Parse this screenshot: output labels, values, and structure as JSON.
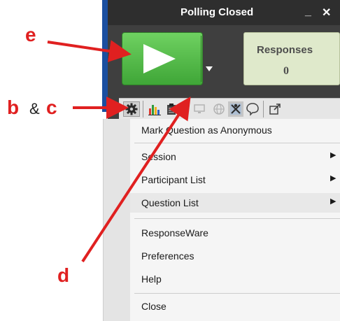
{
  "window": {
    "title": "Polling Closed",
    "minimize_glyph": "_",
    "close_glyph": "✕"
  },
  "start_button": {
    "icon": "play-icon",
    "dropdown_icon": "chevron-down-icon"
  },
  "responses": {
    "label": "Responses",
    "count": "0"
  },
  "toolbar": {
    "tools": [
      "gear-icon",
      "bar-chart-icon",
      "clipboard-icon",
      "monitor-icon",
      "globe-icon",
      "grid-icon",
      "speech-bubble-icon",
      "external-link-icon"
    ]
  },
  "menu": {
    "items": [
      {
        "label": "Mark Question as Anonymous",
        "submenu": false
      },
      {
        "label": "Session",
        "submenu": true
      },
      {
        "label": "Participant List",
        "submenu": true
      },
      {
        "label": "Question List",
        "submenu": true,
        "highlighted": true
      },
      {
        "label": "ResponseWare",
        "submenu": false
      },
      {
        "label": "Preferences",
        "submenu": false
      },
      {
        "label": "Help",
        "submenu": false
      },
      {
        "label": "Close",
        "submenu": false
      }
    ],
    "submenu_glyph": "▶"
  },
  "callouts": {
    "e": "e",
    "b": "b",
    "amp": "&",
    "c": "c",
    "d": "d"
  },
  "colors": {
    "accent_green": "#4cb944",
    "callout_red": "#e02020",
    "window_dark": "#3f3f3f",
    "window_edge_blue": "#1b4fa0",
    "responses_bg": "#dfe9cb"
  }
}
